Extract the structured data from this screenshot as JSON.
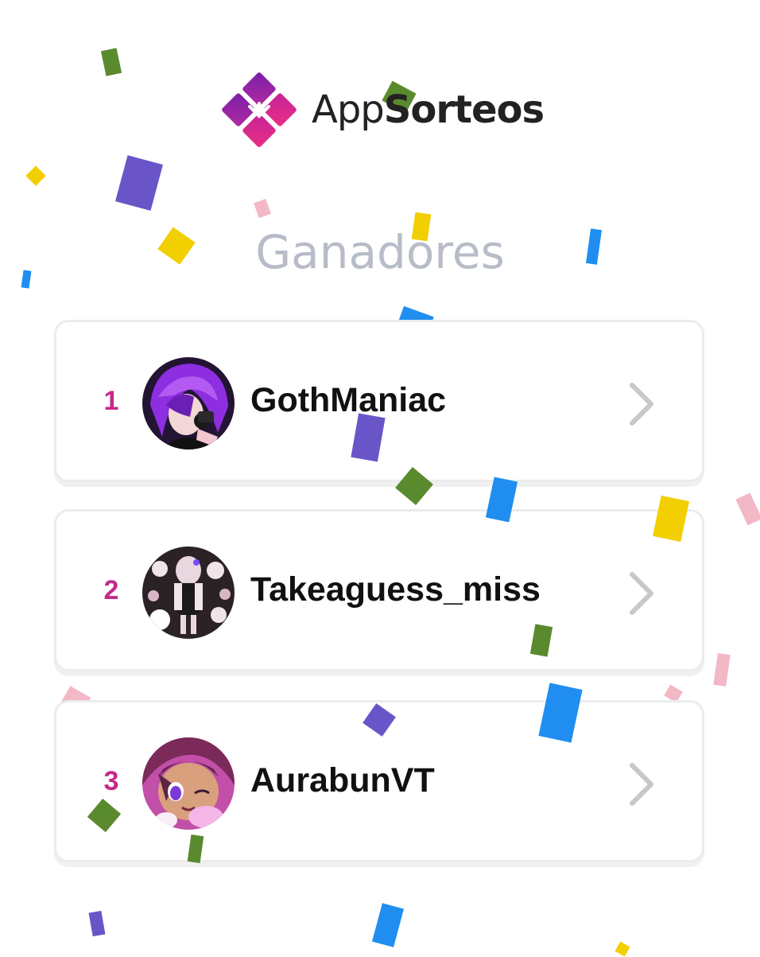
{
  "brand": {
    "name_light": "App",
    "name_bold": "Sorteos",
    "colors": [
      "#8b1fa8",
      "#e0288a"
    ]
  },
  "header": {
    "title": "Ganadores"
  },
  "winners": [
    {
      "rank": "1",
      "name": "GothManiac",
      "avatar": "avatar-purple-hair"
    },
    {
      "rank": "2",
      "name": "Takeaguess_miss",
      "avatar": "avatar-bunny-pattern"
    },
    {
      "rank": "3",
      "name": "AurabunVT",
      "avatar": "avatar-pink-hair"
    }
  ],
  "colors": {
    "accent": "#c4298a",
    "title": "#b7bcc8",
    "chevron": "#c8c8c8"
  }
}
